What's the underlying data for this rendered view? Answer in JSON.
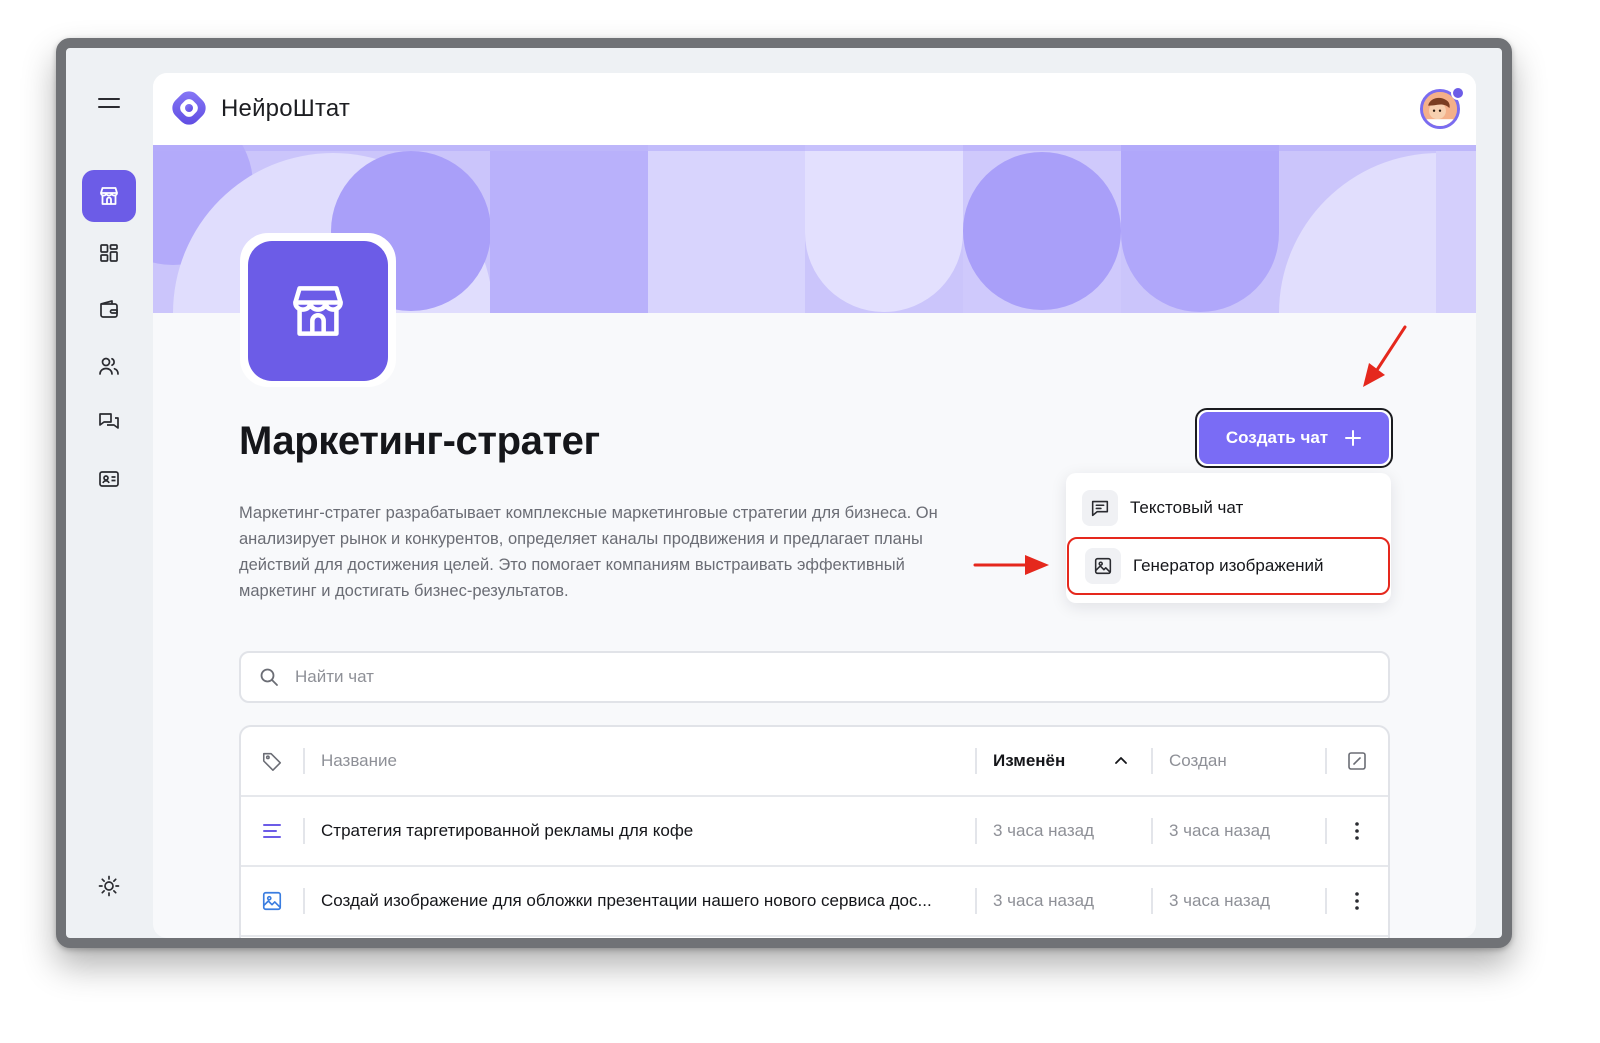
{
  "app": {
    "brand": "НейроШтат"
  },
  "sidebar": {
    "items": [
      {
        "icon": "store-icon",
        "active": true
      },
      {
        "icon": "dashboard-icon",
        "active": false
      },
      {
        "icon": "wallet-icon",
        "active": false
      },
      {
        "icon": "users-icon",
        "active": false
      },
      {
        "icon": "chat-icon",
        "active": false
      },
      {
        "icon": "id-card-icon",
        "active": false
      }
    ],
    "bottom_icon": "sun-icon"
  },
  "page": {
    "title": "Маркетинг-стратег",
    "description": "Маркетинг-стратег разрабатывает комплексные маркетинговые стратегии для бизнеса. Он анализирует рынок и конкурентов, определяет каналы продвижения и предлагает планы действий для достижения целей. Это помогает компаниям выстраивать эффективный маркетинг и достигать бизнес-результатов."
  },
  "create_button": {
    "label": "Создать чат"
  },
  "dropdown": {
    "items": [
      {
        "label": "Текстовый чат",
        "icon": "message-icon"
      },
      {
        "label": "Генератор изображений",
        "icon": "image-icon"
      }
    ]
  },
  "search": {
    "placeholder": "Найти чат"
  },
  "table": {
    "columns": {
      "name": "Название",
      "modified": "Изменён",
      "created": "Создан"
    },
    "rows": [
      {
        "type": "text",
        "name": "Стратегия таргетированной рекламы для кофе",
        "modified": "3 часа назад",
        "created": "3 часа назад"
      },
      {
        "type": "image",
        "name": "Создай изображение для обложки презентации нашего нового сервиса дос...",
        "modified": "3 часа назад",
        "created": "3 часа назад"
      }
    ]
  },
  "colors": {
    "accent": "#6c5ce7",
    "button": "#7a6cf5",
    "banner": "#c9c3fb",
    "annotation": "#e5281d"
  }
}
